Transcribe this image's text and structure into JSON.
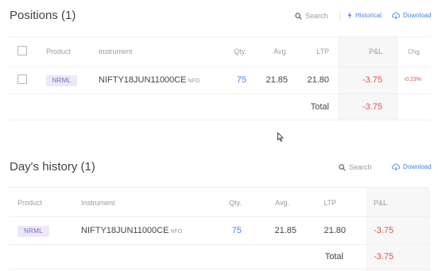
{
  "positions": {
    "title": "Positions (1)",
    "toolbar": {
      "search": "Search",
      "historical": "Historical",
      "download": "Download"
    },
    "headers": {
      "product": "Product",
      "instrument": "Instrument",
      "qty": "Qty.",
      "avg": "Avg.",
      "ltp": "LTP",
      "pnl": "P&L",
      "chg": "Chg."
    },
    "row": {
      "product": "NRML",
      "instrument": "NIFTY18JUN11000CE",
      "exchange": "NFO",
      "qty": "75",
      "avg": "21.85",
      "ltp": "21.80",
      "pnl": "-3.75",
      "chg": "-0.23%"
    },
    "total_label": "Total",
    "total_value": "-3.75"
  },
  "history": {
    "title": "Day's history (1)",
    "toolbar": {
      "search": "Search",
      "download": "Download"
    },
    "headers": {
      "product": "Product",
      "instrument": "Instrument",
      "qty": "Qty.",
      "avg": "Avg.",
      "ltp": "LTP",
      "pnl": "P&L"
    },
    "row": {
      "product": "NRML",
      "instrument": "NIFTY18JUN11000CE",
      "exchange": "NFO",
      "qty": "75",
      "avg": "21.85",
      "ltp": "21.80",
      "pnl": "-3.75"
    },
    "total_label": "Total",
    "total_value": "-3.75"
  },
  "colors": {
    "accent": "#4184f3",
    "loss": "#df514c",
    "badge_bg": "#ece8f8",
    "badge_text": "#7e66c6"
  }
}
